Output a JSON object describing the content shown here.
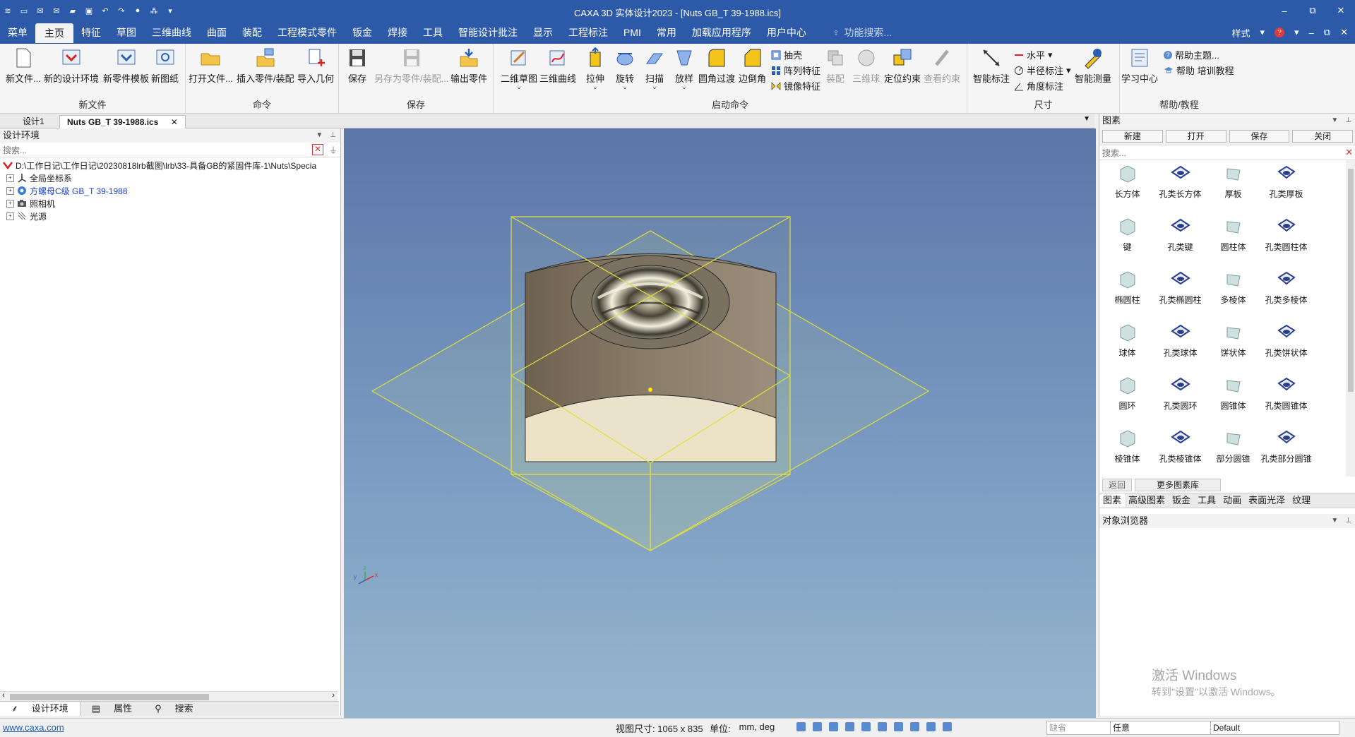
{
  "window": {
    "title": "CAXA 3D 实体设计2023 - [Nuts GB_T 39-1988.ics]",
    "controls": [
      "–",
      "⧉",
      "✕"
    ]
  },
  "menu": {
    "items": [
      "菜单",
      "主页",
      "特征",
      "草图",
      "三维曲线",
      "曲面",
      "装配",
      "工程模式零件",
      "钣金",
      "焊接",
      "工具",
      "智能设计批注",
      "显示",
      "工程标注",
      "PMI",
      "常用",
      "加载应用程序",
      "用户中心"
    ],
    "active": "主页",
    "func_search": "功能搜索...",
    "style_label": "样式",
    "help_icon": "?"
  },
  "ribbon": {
    "groups": {
      "new_file": "新文件",
      "command": "命令",
      "save": "保存",
      "launch": "启动命令",
      "dimension": "尺寸",
      "help": "帮助/教程"
    },
    "buttons": {
      "new_file": "新文件...",
      "new_design_env": "新的设计环境",
      "new_part_template": "新零件模板",
      "new_drawing": "新图纸",
      "open_file": "打开文件...",
      "insert_part": "插入零件/装配",
      "import_geometry": "导入几何",
      "save": "保存",
      "save_as_part": "另存为零件/装配...",
      "output_part": "输出零件",
      "sketch_2d": "二维草图",
      "curve_3d": "三维曲线",
      "extrude": "拉伸",
      "revolve": "旋转",
      "sweep": "扫描",
      "loft": "放样",
      "fillet": "圆角过渡",
      "chamfer": "边倒角",
      "shell": "抽壳",
      "pattern": "阵列特征",
      "mirror": "镜像特征",
      "assembly": "装配",
      "ball_3d": "三维球",
      "position_constraint": "定位约束",
      "view_constraint": "查看约束",
      "smart_dimension": "智能标注",
      "horizontal": "水平",
      "radius_dim": "半径标注",
      "angle_dim": "角度标注",
      "smart_measure": "智能测量",
      "learning_center": "学习中心",
      "help_topics": "帮助主题...",
      "help_training": "帮助 培训教程"
    }
  },
  "doc_tabs": [
    "设计1",
    "Nuts GB_T 39-1988.ics"
  ],
  "left_panel": {
    "title": "设计环境",
    "search_placeholder": "搜索...",
    "tree": [
      {
        "label": "D:\\工作日记\\工作日记\\20230818lrb截图\\lrb\\33-具备GB的紧固件库-1\\Nuts\\Specia",
        "root": true
      },
      {
        "label": "全局坐标系"
      },
      {
        "label": "方螺母C级 GB_T 39-1988",
        "highlight": true
      },
      {
        "label": "照相机"
      },
      {
        "label": "光源"
      }
    ],
    "tabs": [
      "设计环境",
      "属性",
      "搜索"
    ]
  },
  "right_panel": {
    "title": "图素",
    "buttons": [
      "新建",
      "打开",
      "保存",
      "关闭"
    ],
    "search_placeholder": "搜索...",
    "elements": [
      {
        "label": "长方体",
        "icon": "box-icon"
      },
      {
        "label": "孔类长方体",
        "icon": "hole-box-icon"
      },
      {
        "label": "厚板",
        "icon": "thick-plate-icon"
      },
      {
        "label": "孔类厚板",
        "icon": "hole-plate-icon"
      },
      {
        "label": "键",
        "icon": "key-icon"
      },
      {
        "label": "孔类键",
        "icon": "hole-key-icon"
      },
      {
        "label": "圆柱体",
        "icon": "cylinder-icon"
      },
      {
        "label": "孔类圆柱体",
        "icon": "hole-cylinder-icon"
      },
      {
        "label": "椭圆柱",
        "icon": "elliptic-cylinder-icon"
      },
      {
        "label": "孔类椭圆柱",
        "icon": "hole-elliptic-icon"
      },
      {
        "label": "多棱体",
        "icon": "prism-icon"
      },
      {
        "label": "孔类多棱体",
        "icon": "hole-prism-icon"
      },
      {
        "label": "球体",
        "icon": "sphere-icon"
      },
      {
        "label": "孔类球体",
        "icon": "hole-sphere-icon"
      },
      {
        "label": "饼状体",
        "icon": "pie-icon"
      },
      {
        "label": "孔类饼状体",
        "icon": "hole-pie-icon"
      },
      {
        "label": "圆环",
        "icon": "torus-icon"
      },
      {
        "label": "孔类圆环",
        "icon": "hole-torus-icon"
      },
      {
        "label": "圆锥体",
        "icon": "cone-icon"
      },
      {
        "label": "孔类圆锥体",
        "icon": "hole-cone-icon"
      },
      {
        "label": "棱锥体",
        "icon": "pyramid-icon"
      },
      {
        "label": "孔类棱锥体",
        "icon": "hole-pyramid-icon"
      },
      {
        "label": "部分圆锥",
        "icon": "partial-cone-icon"
      },
      {
        "label": "孔类部分圆锥",
        "icon": "hole-partial-cone-icon"
      }
    ],
    "nav": [
      "返回",
      "更多图素库"
    ],
    "category_tabs": [
      "图素",
      "高级图素",
      "钣金",
      "工具",
      "动画",
      "表面光泽",
      "纹理"
    ],
    "object_browser": "对象浏览器"
  },
  "status_bar": {
    "link": "www.caxa.com",
    "view_size": "视图尺寸: 1065 x  835",
    "unit_label": "单位:",
    "unit_value": "mm, deg",
    "dropdown1": "缺省",
    "dropdown2": "任意",
    "dropdown3": "Default"
  },
  "watermark": {
    "line1": "激活 Windows",
    "line2": "转到\"设置\"以激活 Windows。"
  },
  "colors": {
    "titlebar": "#2d5aa8",
    "viewport_top": "#5c75a8",
    "viewport_bottom": "#96b6cf",
    "highlight_text": "#1a3fd1"
  }
}
